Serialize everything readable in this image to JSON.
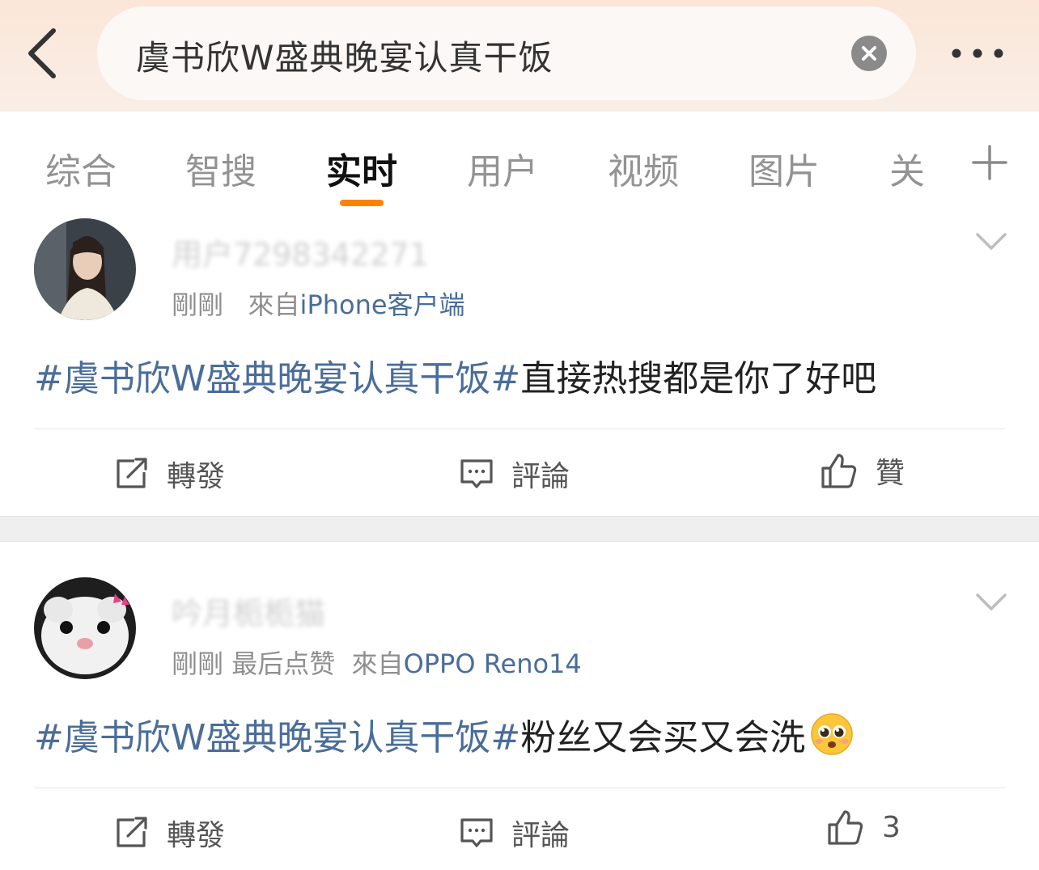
{
  "search": {
    "query": "虞书欣W盛典晚宴认真干饭"
  },
  "tabs": [
    {
      "label": "综合"
    },
    {
      "label": "智搜"
    },
    {
      "label": "实时",
      "active": true
    },
    {
      "label": "用户"
    },
    {
      "label": "视频"
    },
    {
      "label": "图片"
    },
    {
      "label": "关"
    }
  ],
  "posts": [
    {
      "username": "用户7298342271",
      "time": "剛剛",
      "extra": "",
      "source_prefix": "來自",
      "source": "iPhone客户端",
      "hashtag": "#虞书欣W盛典晚宴认真干饭#",
      "text": "直接热搜都是你了好吧",
      "actions": {
        "repost": "轉發",
        "comment": "評論",
        "like": "贊"
      }
    },
    {
      "username": "吟月栀栀猫",
      "time": "剛剛",
      "extra": "最后点赞",
      "source_prefix": "來自",
      "source": "OPPO Reno14",
      "hashtag": "#虞书欣W盛典晚宴认真干饭#",
      "text": "粉丝又会买又会洗",
      "emoji": "pleading-face-emoji",
      "actions": {
        "repost": "轉發",
        "comment": "評論",
        "like": "3"
      }
    }
  ],
  "colors": {
    "accent": "#ff8200",
    "link": "#4a6d9a",
    "muted": "#8f8f8f"
  }
}
